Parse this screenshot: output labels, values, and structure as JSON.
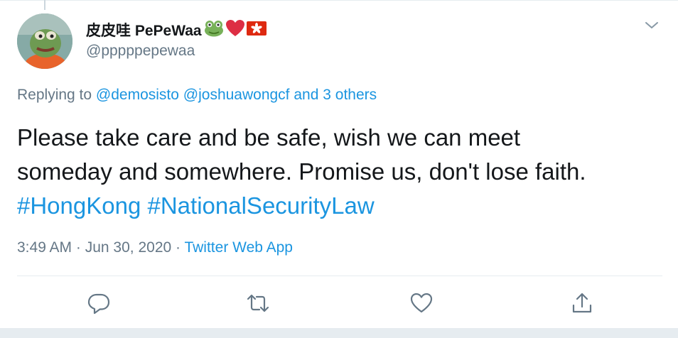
{
  "tweet": {
    "display_name": "皮皮哇 PePeWaa",
    "handle": "@pppppepewaa",
    "name_emojis": [
      "frog-icon",
      "red-heart-icon",
      "hong-kong-flag-icon"
    ],
    "replying": {
      "prefix": "Replying to ",
      "mention_1": "@demosisto",
      "mention_2": "@joshuawongcf",
      "others": "and 3 others"
    },
    "text": {
      "line_1": "Please take care and be safe, wish we can meet",
      "line_2": "someday and somewhere. Promise us, don't lose faith.",
      "hashtag_1": "#HongKong",
      "hashtag_2": "#NationalSecurityLaw"
    },
    "meta": {
      "time": "3:49 AM",
      "separator": " · ",
      "date": "Jun 30, 2020",
      "source": "Twitter Web App"
    },
    "actions": [
      "reply-icon",
      "retweet-icon",
      "like-icon",
      "share-icon"
    ]
  },
  "colors": {
    "link": "#1b95e0",
    "secondary_text": "#657786",
    "icon": "#657786",
    "divider": "#e6ecf0"
  }
}
